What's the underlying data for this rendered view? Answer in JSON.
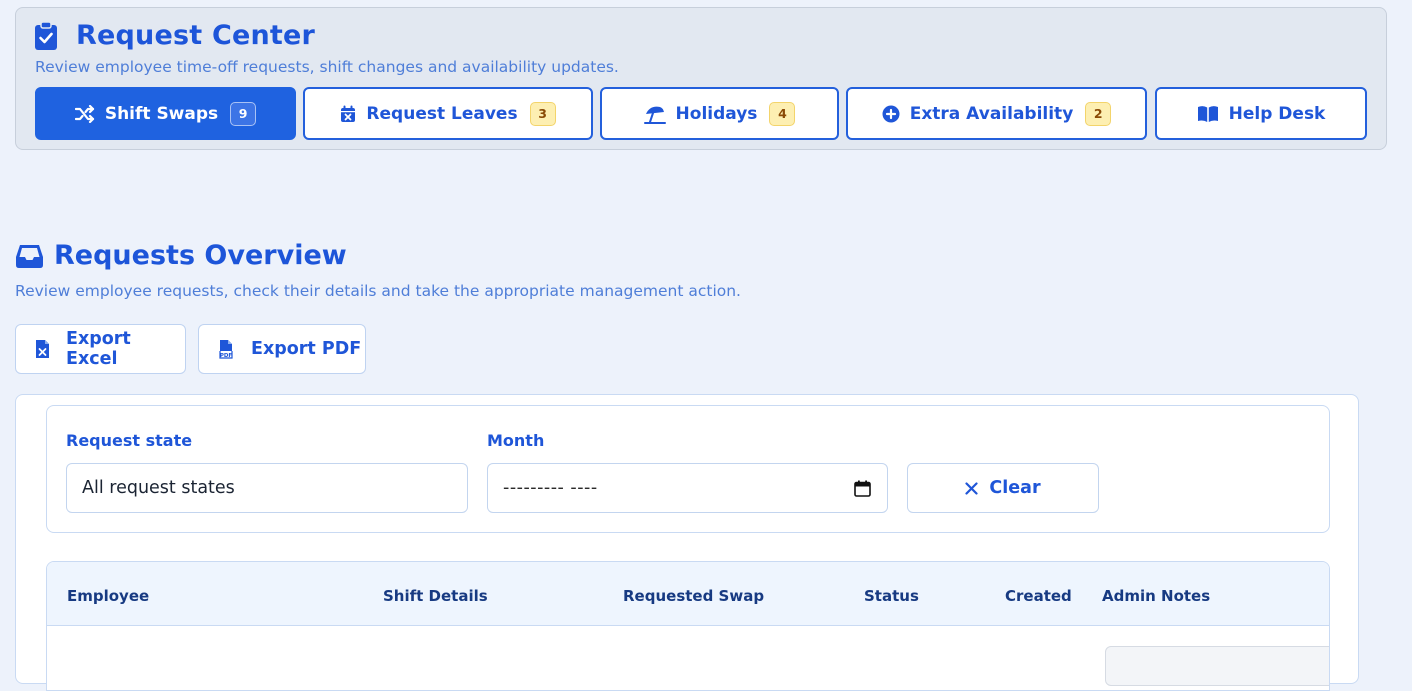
{
  "header": {
    "title": "Request Center",
    "subtitle": "Review employee time-off requests, shift changes and availability updates."
  },
  "tabs": [
    {
      "label": "Shift Swaps",
      "badge": "9",
      "active": true,
      "icon": "shuffle-icon"
    },
    {
      "label": "Request Leaves",
      "badge": "3",
      "active": false,
      "icon": "calendar-x-icon"
    },
    {
      "label": "Holidays",
      "badge": "4",
      "active": false,
      "icon": "beach-umbrella-icon"
    },
    {
      "label": "Extra Availability",
      "badge": "2",
      "active": false,
      "icon": "plus-circle-icon"
    },
    {
      "label": "Help Desk",
      "badge": "",
      "active": false,
      "icon": "book-open-icon"
    }
  ],
  "overview": {
    "title": "Requests Overview",
    "subtitle": "Review employee requests, check their details and take the appropriate management action.",
    "export_excel": "Export Excel",
    "export_pdf": "Export PDF"
  },
  "filters": {
    "state_label": "Request state",
    "state_value": "All request states",
    "month_label": "Month",
    "month_value": "--------- ----",
    "clear_label": "Clear"
  },
  "table": {
    "columns": [
      "Employee",
      "Shift Details",
      "Requested Swap",
      "Status",
      "Created",
      "Admin Notes"
    ]
  },
  "colors": {
    "primary": "#1f62e0",
    "text_blue": "#1f56d8",
    "badge_bg": "#fdefb2",
    "page_bg": "#edf2fb"
  }
}
